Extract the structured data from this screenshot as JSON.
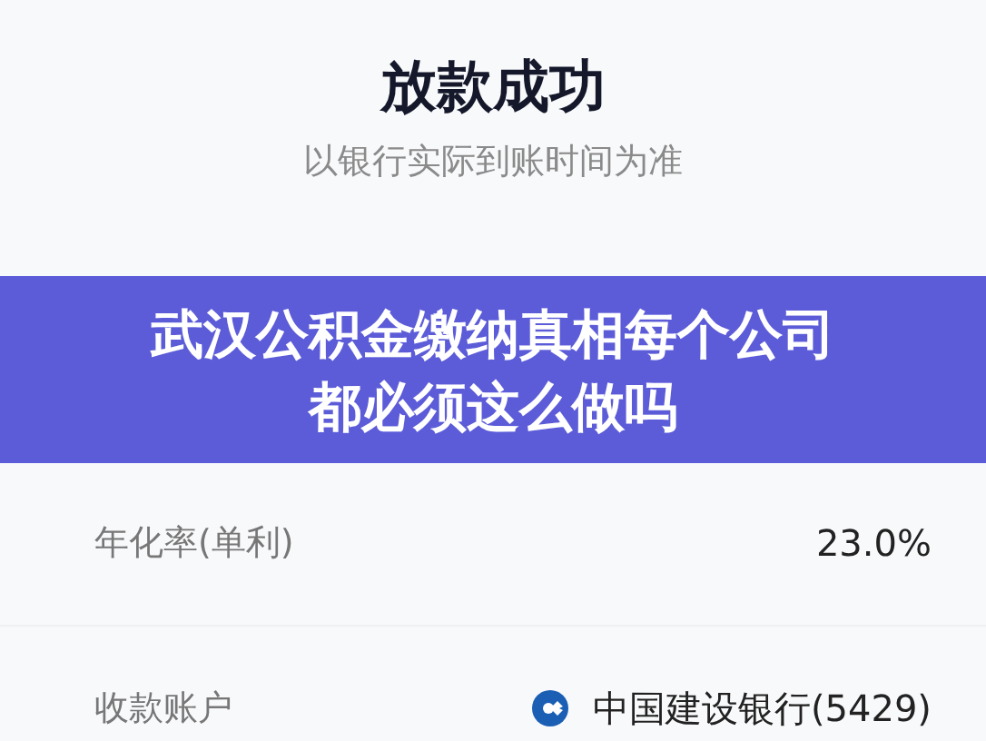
{
  "header": {
    "title": "放款成功",
    "subtitle": "以银行实际到账时间为准"
  },
  "rows": [
    {
      "kind": "text",
      "label": "年化率(单利)",
      "value": "23.0%"
    },
    {
      "kind": "bank",
      "label": "收款账户",
      "value": "中国建设银行(5429)"
    }
  ],
  "banner": {
    "text": "武汉公积金缴纳真相每个公司都必须这么做吗"
  }
}
